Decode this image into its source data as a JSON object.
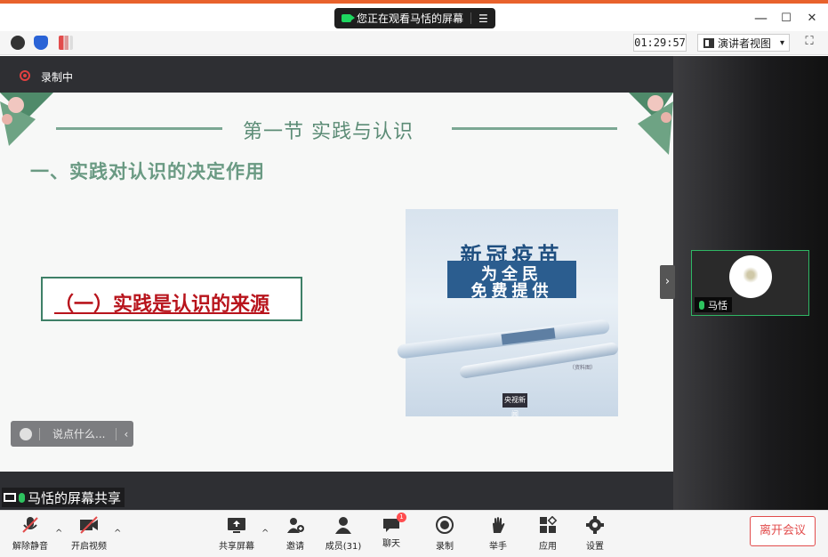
{
  "window": {
    "sharing_notice": "您正在观看马恬的屏幕",
    "menu_glyph": "☰",
    "minimize": "—",
    "maximize": "☐",
    "close": "✕"
  },
  "toolbar": {
    "timer": "01:29:57",
    "view_mode": "演讲者视图",
    "view_caret": "▾",
    "fullscreen": "⛶"
  },
  "recording": {
    "label": "录制中"
  },
  "slide": {
    "title": "第一节  实践与认识",
    "heading": "一、实践对认识的决定作用",
    "box_text": "（一）实践是认识的来源",
    "vaccine": {
      "title": "新冠疫苗",
      "line1": "为全民",
      "line2": "免费提供",
      "note": "（资料图）",
      "logo": "央视新闻"
    }
  },
  "chat": {
    "placeholder": "说点什么...",
    "arrow": "‹"
  },
  "share_label": "马恬的屏幕共享",
  "participant": {
    "name": "马恬"
  },
  "collapse_glyph": "›",
  "controls": {
    "mute": "解除静音",
    "video": "开启视频",
    "share": "共享屏幕",
    "invite": "邀请",
    "members": "成员(31)",
    "chat": "聊天",
    "chat_badge": "1",
    "record": "录制",
    "raise_hand": "举手",
    "apps": "应用",
    "settings": "设置",
    "leave": "离开会议",
    "caret": "^"
  }
}
